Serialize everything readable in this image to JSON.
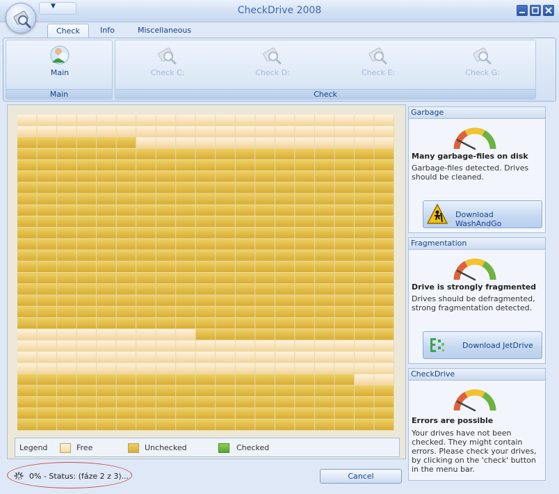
{
  "window": {
    "title": "CheckDrive 2008",
    "qat_icon": "chevron-down-icon",
    "controls": [
      "minimize-icon",
      "maximize-icon",
      "close-icon"
    ]
  },
  "tabs": [
    {
      "label": "Check",
      "active": true
    },
    {
      "label": "Info",
      "active": false
    },
    {
      "label": "Miscellaneous",
      "active": false
    }
  ],
  "ribbon": {
    "main_group": {
      "label": "Main",
      "button": {
        "label": "Main",
        "icon": "user-icon"
      }
    },
    "check_group": {
      "label": "Check",
      "buttons": [
        {
          "label": "Check C:",
          "icon": "drive-search-icon",
          "enabled": false
        },
        {
          "label": "Check D:",
          "icon": "drive-search-icon",
          "enabled": false
        },
        {
          "label": "Check E:",
          "icon": "drive-search-icon",
          "enabled": false
        },
        {
          "label": "Check G:",
          "icon": "drive-search-icon",
          "enabled": false
        }
      ]
    }
  },
  "disk_map": {
    "columns": 19,
    "rows": 28,
    "free_cells_by_row": {
      "0": [
        0,
        19
      ],
      "1": [
        0,
        19
      ],
      "2": [
        6,
        19
      ],
      "19": [
        0,
        9
      ],
      "20": [
        0,
        19
      ],
      "21": [
        0,
        19
      ],
      "22": [
        0,
        19
      ],
      "23": [
        17,
        19
      ]
    },
    "colors": {
      "free": "#fbe7bf",
      "unchecked": "#e2be45",
      "checked": "#6fb83a"
    }
  },
  "legend": {
    "title": "Legend",
    "items": [
      {
        "label": "Free",
        "color": "#fbe7bf"
      },
      {
        "label": "Unchecked",
        "color": "#e2be45"
      },
      {
        "label": "Checked",
        "color": "#6fb83a"
      }
    ]
  },
  "status": {
    "text": "0% - Status: (fáze 2 z 3)...",
    "cancel_label": "Cancel"
  },
  "panels": {
    "garbage": {
      "header": "Garbage",
      "title": "Many garbage-files on disk",
      "text": "Garbage-files detected. Drives should be cleaned.",
      "button": "Download WashAndGo",
      "gauge_level": 0.15
    },
    "fragmentation": {
      "header": "Fragmentation",
      "title": "Drive is strongly fragmented",
      "text": "Drives should be defragmented, strong fragmentation detected.",
      "button": "Download JetDrive",
      "gauge_level": 0.15
    },
    "checkdrive": {
      "header": "CheckDrive",
      "title": "Errors are possible",
      "text": "Your drives have not been checked. They might contain errors. Please check your drives, by clicking on the 'check' button in the menu bar.",
      "gauge_level": 0.15
    }
  }
}
